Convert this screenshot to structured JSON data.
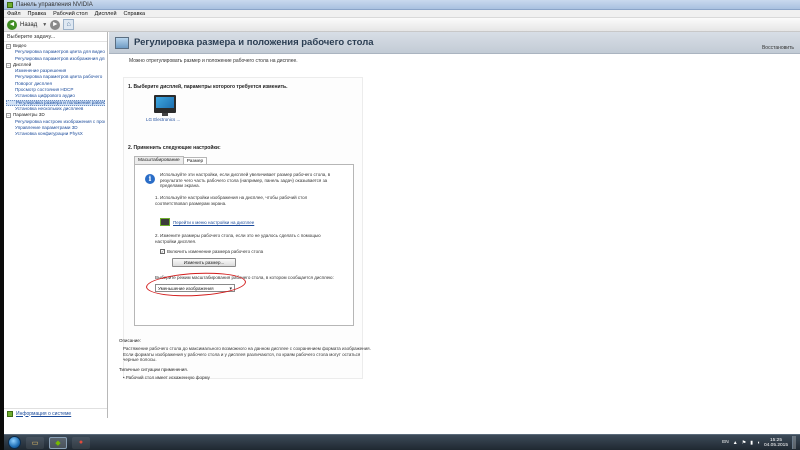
{
  "window": {
    "title": "Панель управления NVIDIA"
  },
  "menu": [
    "Файл",
    "Правка",
    "Рабочий стол",
    "Дисплей",
    "Справка"
  ],
  "toolbar": {
    "back_label": "Назад",
    "back_glyph": "◄",
    "forward_glyph": "►",
    "home_glyph": "⌂",
    "caret": "▼"
  },
  "sidebar": {
    "header": "Выберите задачу...",
    "items": [
      {
        "label": "Видео",
        "level": 0,
        "expander": "−"
      },
      {
        "label": "Регулировка параметров цвета для видео",
        "level": 1
      },
      {
        "label": "Регулировка параметров изображения для видео",
        "level": 1
      },
      {
        "label": "Дисплей",
        "level": 0,
        "expander": "−"
      },
      {
        "label": "Изменение разрешения",
        "level": 1
      },
      {
        "label": "Регулировка параметров цвета рабочего",
        "level": 1
      },
      {
        "label": "Поворот дисплея",
        "level": 1
      },
      {
        "label": "Просмотр состояния HDCP",
        "level": 1
      },
      {
        "label": "Установка цифрового аудио",
        "level": 1
      },
      {
        "label": "Регулировка размера и положения рабочего",
        "level": 1,
        "selected": true
      },
      {
        "label": "Установка нескольких дисплеев",
        "level": 1
      },
      {
        "label": "Параметры 3D",
        "level": 0,
        "expander": "−"
      },
      {
        "label": "Регулировка настроек изображения с просм",
        "level": 1
      },
      {
        "label": "Управление параметрами 3D",
        "level": 1
      },
      {
        "label": "Установка конфигурации PhysX",
        "level": 1
      }
    ],
    "footer_link": "Информация о системе"
  },
  "page": {
    "title": "Регулировка размера и положения рабочего стола",
    "restore": "Восстановить",
    "subtitle": "Можно отрегулировать размер и положение рабочего стола на дисплее.",
    "step1": "1. Выберите дисплей, параметры которого требуется изменить.",
    "monitor_label": "LG Electronics ...",
    "step2": "2. Применить следующие настройки:",
    "tabs": [
      {
        "label": "Масштабирование",
        "active": false
      },
      {
        "label": "Размер",
        "active": true
      }
    ],
    "info_glyph": "i",
    "info_text": "Используйте эти настройки, если дисплей увеличивает размер рабочего стола, в результате чего часть рабочего стола (например, панель задач) оказывается за пределами экрана.",
    "option1": "1. Используйте настройки изображения на дисплее, чтобы рабочий стол соответствовал размерам экрана.",
    "option1_link": "Перейти к меню настройки на дисплее",
    "option2": "2. Измените размеры рабочего стола, если это не удалось сделать с помощью настройки дисплея.",
    "checkbox_label": "Включить изменение размера рабочего стола",
    "checkbox_mark": "✓",
    "resize_button": "Изменить размер...",
    "scale_label": "Выберите режим масштабирования рабочего стола, в котором сообщается дисплею:",
    "scale_value": "Уменьшение изображения",
    "scale_dd": "▾",
    "desc_head": "Описание:",
    "desc_text": "Растяжение рабочего стола до максимального возможного на данном дисплее с сохранением формата изображения. Если форматы изображения у рабочего стола и у дисплея различаются, по краям рабочего стола могут остаться черные полосы.",
    "typical_head": "Типичные ситуации применения.",
    "typical_item": "• Рабочий стол имеет искаженную форму"
  },
  "taskbar": {
    "explorer_glyph": "▭",
    "nvidia_glyph": "◆",
    "chrome_glyph": "●",
    "lang": "EN",
    "tray_up": "▲",
    "tray_flag": "⚑",
    "tray_net": "▮",
    "tray_vol": "◖",
    "time": "15:25",
    "date": "04.05.2015"
  }
}
